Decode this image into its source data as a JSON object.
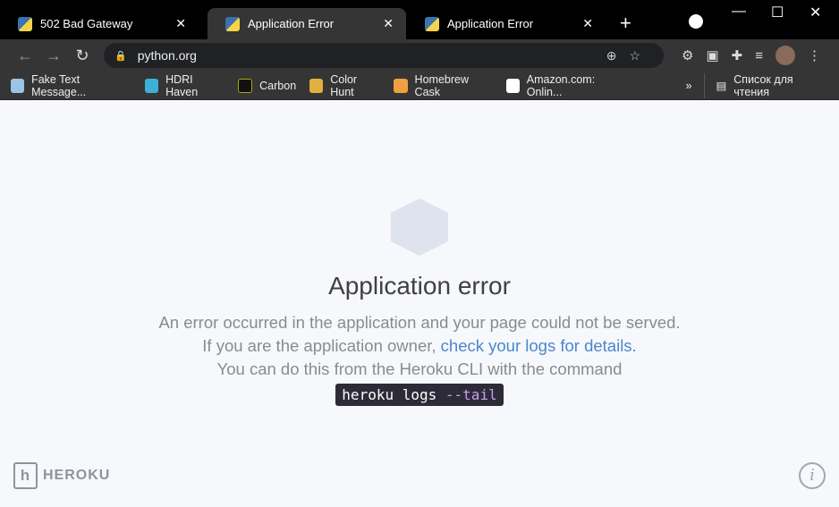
{
  "tabs": [
    {
      "title": "502 Bad Gateway",
      "active": false
    },
    {
      "title": "Application Error",
      "active": true
    },
    {
      "title": "Application Error",
      "active": false
    }
  ],
  "url": "python.org",
  "bookmarks": [
    "Fake Text Message...",
    "HDRI Haven",
    "Carbon",
    "Color Hunt",
    "Homebrew Cask",
    "Amazon.com: Onlin..."
  ],
  "reading_list": "Список для чтения",
  "page": {
    "title": "Application error",
    "line1": "An error occurred in the application and your page could not be served. If you are the application owner, ",
    "link": "check your logs for details.",
    "line2": "You can do this from the Heroku CLI with the command",
    "cmd": "heroku logs",
    "cmd_flag": "--tail",
    "brand": "HEROKU",
    "info": "i"
  }
}
